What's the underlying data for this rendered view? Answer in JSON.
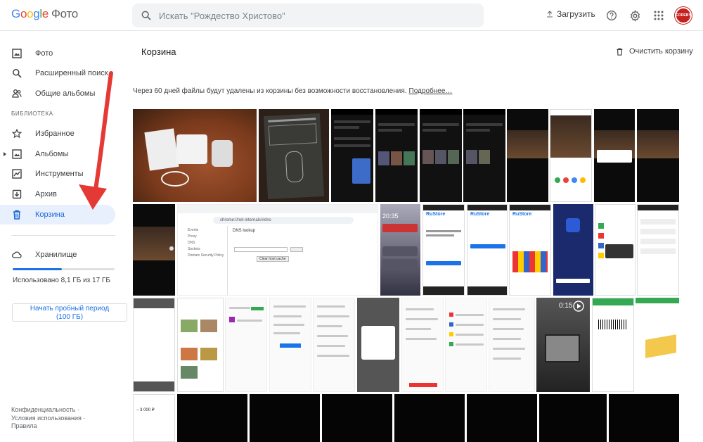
{
  "app": {
    "logo_word": [
      "G",
      "o",
      "o",
      "g",
      "l",
      "e"
    ],
    "product": "Фото",
    "search_placeholder": "Искать \"Рождество Христово\"",
    "upload_label": "Загрузить",
    "avatar_text": "CODEBY"
  },
  "sidebar": {
    "items": [
      {
        "label": "Фото",
        "icon": "photo-icon"
      },
      {
        "label": "Расширенный поиск",
        "icon": "search-icon"
      },
      {
        "label": "Общие альбомы",
        "icon": "people-icon"
      }
    ],
    "library_label": "БИБЛИОТЕКА",
    "library_items": [
      {
        "label": "Избранное",
        "icon": "star-icon"
      },
      {
        "label": "Альбомы",
        "icon": "album-icon"
      },
      {
        "label": "Инструменты",
        "icon": "tools-icon"
      },
      {
        "label": "Архив",
        "icon": "archive-icon"
      },
      {
        "label": "Корзина",
        "icon": "trash-icon",
        "active": true
      }
    ],
    "storage_label": "Хранилище",
    "storage_used_fraction": 0.48,
    "storage_text": "Использовано 8,1 ГБ из 17 ГБ",
    "trial_button_line1": "Начать пробный период",
    "trial_button_line2": "(100 ГБ)",
    "footer": [
      "Конфиденциальность",
      "Условия использования",
      "Правила"
    ],
    "footer_sep": "·"
  },
  "main": {
    "title": "Корзина",
    "clear_label": "Очистить корзину",
    "info_text": "Через 60 дней файлы будут удалены из корзины без возможности восстановления.",
    "info_link": "Подробнее…"
  },
  "thumb_text": {
    "rustore": "RuStore",
    "clock": "20:35",
    "video_time": "0:15",
    "price": "− 3 000 ₽",
    "url": "chrome://net-internals/#dns",
    "dns_menu": [
      "Events",
      "Proxy",
      "DNS",
      "Sockets",
      "Domain Security Policy"
    ],
    "dns_lookup": "DNS lookup",
    "clear_cache": "Clear host cache"
  },
  "colors": {
    "accent": "#1a73e8",
    "active_bg": "#e8f0fe",
    "arrow": "#e53935",
    "avatar": "#c5221f"
  }
}
